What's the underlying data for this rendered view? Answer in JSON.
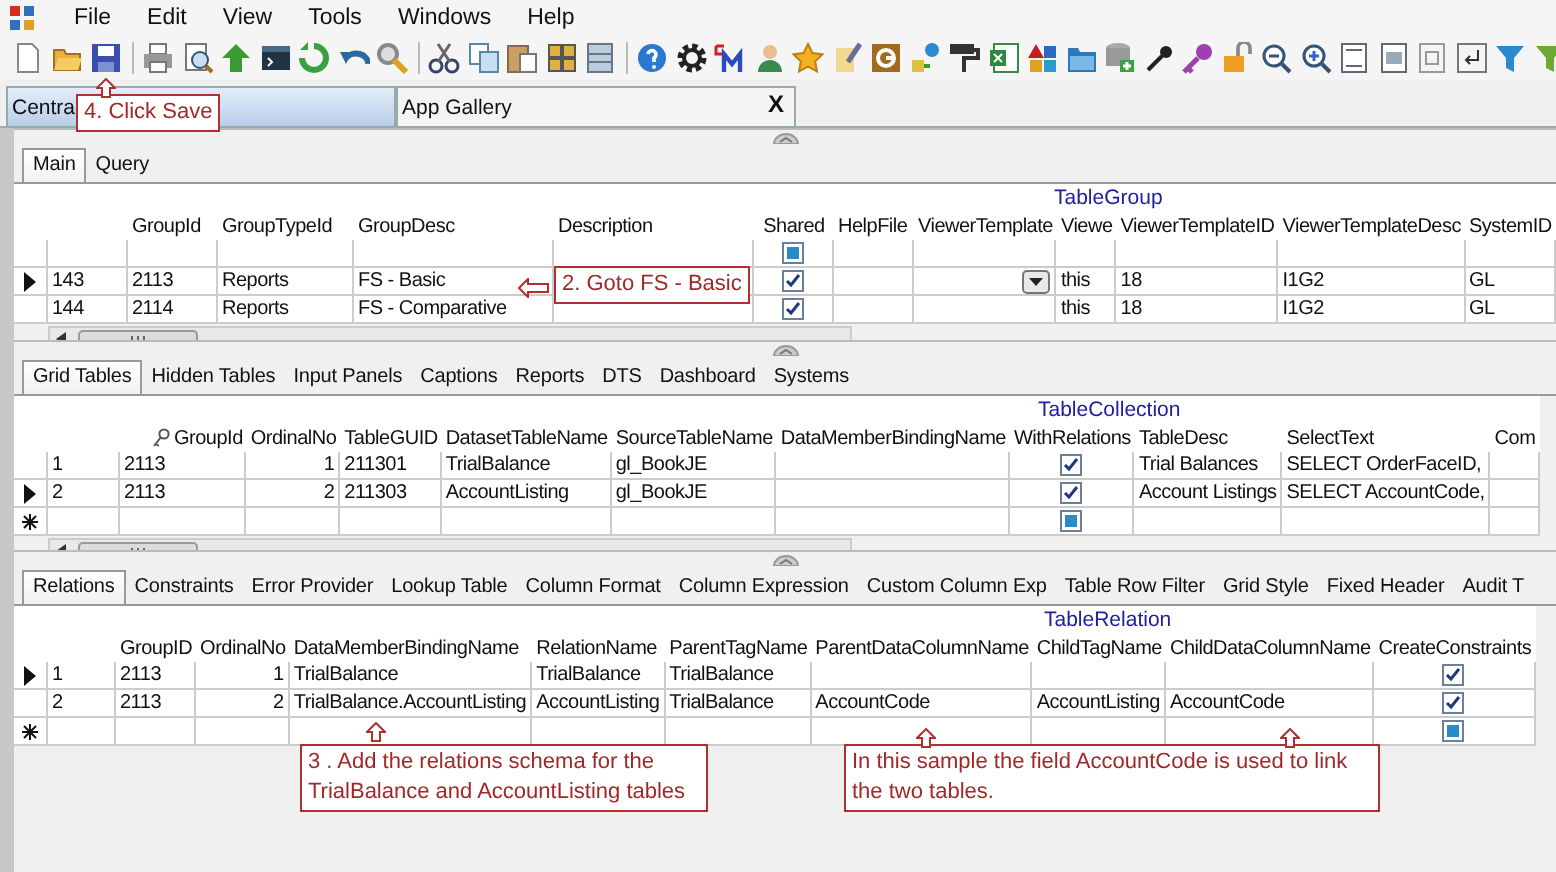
{
  "menu": [
    "File",
    "Edit",
    "View",
    "Tools",
    "Windows",
    "Help"
  ],
  "document_tabs": [
    {
      "label": "Centra",
      "selected": true
    },
    {
      "label": "App Gallery",
      "selected": false
    }
  ],
  "document_close": "X",
  "panels": [
    {
      "tabs": [
        {
          "label": "Main",
          "selected": true
        },
        {
          "label": "Query",
          "selected": false
        }
      ],
      "title": "TableGroup",
      "columns": [
        {
          "kind": "text"
        },
        {
          "label": "GroupId",
          "kind": "text"
        },
        {
          "label": "GroupTypeId",
          "kind": "text"
        },
        {
          "label": "GroupDesc",
          "kind": "text"
        },
        {
          "label": "Description",
          "kind": "text"
        },
        {
          "label": "Shared",
          "kind": "check"
        },
        {
          "label": "HelpFile",
          "kind": "text"
        },
        {
          "label": "ViewerTemplate",
          "kind": "combo"
        },
        {
          "label": "Viewe",
          "kind": "text"
        },
        {
          "label": "ViewerTemplateID",
          "kind": "text"
        },
        {
          "label": "ViewerTemplateDesc",
          "kind": "text"
        },
        {
          "label": "SystemID",
          "kind": "text"
        }
      ],
      "rows": [
        {
          "kind": "filter",
          "current": false,
          "cells": [
            "",
            "",
            "",
            "",
            "",
            {
              "checked": false,
              "indeterminate": true
            },
            "",
            "",
            "",
            "",
            "",
            ""
          ]
        },
        {
          "kind": "data",
          "current": true,
          "cells": [
            "143",
            "2113",
            "Reports",
            "FS - Basic",
            "",
            {
              "checked": true,
              "indeterminate": false
            },
            "",
            "",
            "this",
            "18",
            "I1G2",
            "GL"
          ]
        },
        {
          "kind": "data",
          "current": false,
          "cells": [
            "144",
            "2114",
            "Reports",
            "FS - Comparative",
            "",
            {
              "checked": true,
              "indeterminate": false
            },
            "",
            "",
            "this",
            "18",
            "I1G2",
            "GL"
          ]
        }
      ]
    },
    {
      "tabs": [
        {
          "label": "Grid Tables",
          "selected": true
        },
        {
          "label": "Hidden Tables",
          "selected": false
        },
        {
          "label": "Input Panels",
          "selected": false
        },
        {
          "label": "Captions",
          "selected": false
        },
        {
          "label": "Reports",
          "selected": false
        },
        {
          "label": "DTS",
          "selected": false
        },
        {
          "label": "Dashboard",
          "selected": false
        },
        {
          "label": "Systems",
          "selected": false
        }
      ],
      "title": "TableCollection",
      "columns": [
        {
          "kind": "text"
        },
        {
          "label": "GroupId",
          "kind": "text",
          "key": true
        },
        {
          "label": "OrdinalNo",
          "kind": "number"
        },
        {
          "label": "TableGUID",
          "kind": "text"
        },
        {
          "label": "DatasetTableName",
          "kind": "text"
        },
        {
          "label": "SourceTableName",
          "kind": "text"
        },
        {
          "label": "DataMemberBindingName",
          "kind": "text"
        },
        {
          "label": "WithRelations",
          "kind": "check"
        },
        {
          "label": "TableDesc",
          "kind": "text"
        },
        {
          "label": "SelectText",
          "kind": "text"
        },
        {
          "label": "Com",
          "kind": "text"
        }
      ],
      "rows": [
        {
          "kind": "data",
          "current": false,
          "cells": [
            "1",
            "2113",
            "1",
            "211301",
            "TrialBalance",
            "gl_BookJE",
            "",
            {
              "checked": true,
              "indeterminate": false
            },
            "Trial Balances",
            "SELECT OrderFaceID,",
            ""
          ]
        },
        {
          "kind": "data",
          "current": true,
          "cells": [
            "2",
            "2113",
            "2",
            "211303",
            "AccountListing",
            "gl_BookJE",
            "",
            {
              "checked": true,
              "indeterminate": false
            },
            "Account Listings",
            "SELECT AccountCode,",
            ""
          ]
        },
        {
          "kind": "new",
          "current": false,
          "cells": [
            "",
            "",
            "",
            "",
            "",
            "",
            "",
            {
              "checked": false,
              "indeterminate": true
            },
            "",
            "",
            ""
          ]
        }
      ]
    },
    {
      "tabs": [
        {
          "label": "Relations",
          "selected": true
        },
        {
          "label": "Constraints",
          "selected": false
        },
        {
          "label": "Error Provider",
          "selected": false
        },
        {
          "label": "Lookup Table",
          "selected": false
        },
        {
          "label": "Column Format",
          "selected": false
        },
        {
          "label": "Column Expression",
          "selected": false
        },
        {
          "label": "Custom Column Exp",
          "selected": false
        },
        {
          "label": "Table Row Filter",
          "selected": false
        },
        {
          "label": "Grid Style",
          "selected": false
        },
        {
          "label": "Fixed Header",
          "selected": false
        },
        {
          "label": "Audit T",
          "selected": false
        }
      ],
      "title": "TableRelation",
      "columns": [
        {
          "kind": "text"
        },
        {
          "label": "GroupID",
          "kind": "text"
        },
        {
          "label": "OrdinalNo",
          "kind": "number"
        },
        {
          "label": "DataMemberBindingName",
          "kind": "text"
        },
        {
          "label": "RelationName",
          "kind": "text"
        },
        {
          "label": "ParentTagName",
          "kind": "text"
        },
        {
          "label": "ParentDataColumnName",
          "kind": "text"
        },
        {
          "label": "ChildTagName",
          "kind": "text"
        },
        {
          "label": "ChildDataColumnName",
          "kind": "text"
        },
        {
          "label": "CreateConstraints",
          "kind": "check"
        }
      ],
      "rows": [
        {
          "kind": "data",
          "current": true,
          "cells": [
            "1",
            "2113",
            "1",
            "TrialBalance",
            "TrialBalance",
            "TrialBalance",
            "",
            "",
            "",
            {
              "checked": true,
              "indeterminate": false
            }
          ]
        },
        {
          "kind": "data",
          "current": false,
          "cells": [
            "2",
            "2113",
            "2",
            "TrialBalance.AccountListing",
            "AccountListing",
            "TrialBalance",
            "AccountCode",
            "AccountListing",
            "AccountCode",
            {
              "checked": true,
              "indeterminate": false
            }
          ]
        },
        {
          "kind": "new",
          "current": false,
          "cells": [
            "",
            "",
            "",
            "",
            "",
            "",
            "",
            "",
            "",
            {
              "checked": false,
              "indeterminate": true
            }
          ]
        }
      ]
    }
  ],
  "callouts": [
    {
      "text": "4. Click Save"
    },
    {
      "text": "2. Goto FS - Basic"
    },
    {
      "text": "3 . Add the relations schema for the TrialBalance and AccountListing tables"
    },
    {
      "text": "In this sample the field AccountCode is used to link the two tables."
    }
  ]
}
